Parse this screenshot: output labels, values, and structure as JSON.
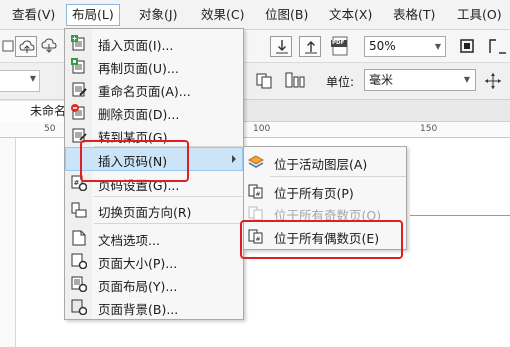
{
  "menubar": {
    "items": [
      "查看(V)",
      "布局(L)",
      "对象(J)",
      "效果(C)",
      "位图(B)",
      "文本(X)",
      "表格(T)",
      "工具(O)"
    ]
  },
  "toolbar": {
    "zoom_value": "50%",
    "pdf_label": "PDF"
  },
  "propbar": {
    "unit_label": "单位:",
    "unit_value": "毫米"
  },
  "document": {
    "tab_title": "未命名"
  },
  "ruler": {
    "labels": [
      "50",
      "100",
      "150"
    ]
  },
  "layout_menu": {
    "items": [
      {
        "label": "插入页面(I)...",
        "icon": "insert-page-icon"
      },
      {
        "label": "再制页面(U)...",
        "icon": "duplicate-page-icon"
      },
      {
        "label": "重命名页面(A)...",
        "icon": "rename-page-icon"
      },
      {
        "label": "删除页面(D)...",
        "icon": "delete-page-icon"
      },
      {
        "label": "转到某页(G)...",
        "icon": "goto-page-icon"
      },
      {
        "label": "插入页码(N)",
        "icon": "",
        "has_submenu": true,
        "highlighted": true
      },
      {
        "label": "页码设置(G)...",
        "icon": "page-number-settings-icon"
      },
      {
        "label": "切换页面方向(R)",
        "icon": "switch-orientation-icon"
      },
      {
        "label": "文档选项...",
        "icon": "document-options-icon"
      },
      {
        "label": "页面大小(P)...",
        "icon": "page-size-icon"
      },
      {
        "label": "页面布局(Y)...",
        "icon": "page-layout-icon"
      },
      {
        "label": "页面背景(B)...",
        "icon": "page-background-icon"
      }
    ]
  },
  "submenu": {
    "items": [
      {
        "label": "位于活动图层(A)",
        "icon": "layers-icon",
        "enabled": true
      },
      {
        "label": "位于所有页(P)",
        "icon": "all-pages-icon",
        "enabled": true
      },
      {
        "label": "位于所有奇数页(O)",
        "icon": "odd-pages-icon",
        "enabled": false
      },
      {
        "label": "位于所有偶数页(E)",
        "icon": "even-pages-icon",
        "enabled": true
      }
    ]
  },
  "colors": {
    "highlight": "#cce4f7",
    "annotation_red": "#e02020",
    "menu_bg": "#f7f7f7"
  }
}
